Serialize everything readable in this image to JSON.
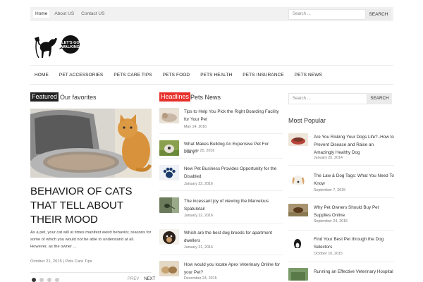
{
  "top_nav": {
    "items": [
      "Home",
      "About US",
      "Contact US"
    ],
    "search_placeholder": "Search ...",
    "search_button": "SEARCH"
  },
  "logo": {
    "text": "LET'S GO WALKING"
  },
  "main_nav": {
    "items": [
      "HOME",
      "PET ACCESSORIES",
      "PETS CARE TIPS",
      "PETS FOOD",
      "PETS HEALTH",
      "PETS INSURANCE",
      "PETS NEWS"
    ]
  },
  "featured": {
    "tag": "Featured",
    "subtitle": "Our favorites",
    "tag_color": "#222222",
    "title": "BEHAVIOR OF CATS THAT TELL ABOUT THEIR MOOD",
    "excerpt": "As a pet, your cat will at times manifest weird behavior, reasons for some of which you would not be able to understand at all. However, as the owner ...",
    "date": "October 21, 2015",
    "separator": "|",
    "category": "Pets Care Tips",
    "slider_dots": 4,
    "active_dot": 0,
    "prev": "PREV",
    "next": "NEXT"
  },
  "headlines": {
    "tag": "Headlines",
    "subtitle": "Pets News",
    "tag_color": "#e8302a",
    "items": [
      {
        "title": "Tips to Help You Pick the Right Boarding Facility for Your Pet",
        "date": "May 14, 2016",
        "thumb": "dog-sleeping",
        "thumb_color": "#c9b8a6"
      },
      {
        "title": "What Makes Bulldog An Expensive Pet For Many?",
        "date": "February 25, 2016",
        "thumb": "bulldog",
        "thumb_color": "#7d8f4a"
      },
      {
        "title": "New Pet Business Provides Opportunity for the Disabled",
        "date": "January 22, 2016",
        "thumb": "paw-print",
        "thumb_color": "#e8eef4"
      },
      {
        "title": "The incessant joy of viewing the Marvelous Spatuletail",
        "date": "January 22, 2016",
        "thumb": "bird",
        "thumb_color": "#5a6a4c"
      },
      {
        "title": "Which are the best dog breeds for apartment dwellers",
        "date": "January 21, 2016",
        "thumb": "dog-face",
        "thumb_color": "#3a2c22"
      },
      {
        "title": "How would you locate Apex Veterinary Online for your Pet?",
        "date": "December 24, 2015",
        "thumb": "puppies",
        "thumb_color": "#d8c29e"
      }
    ]
  },
  "sidebar": {
    "search_placeholder": "Search ...",
    "search_button": "SEARCH",
    "popular_title": "Most Popular",
    "items": [
      {
        "title": "Are You Risking Your Dogs Life?..How to Prevent Disease and Raise an Amazingly Healthy Dog",
        "date": "January 25, 2014",
        "thumb": "dog-food",
        "thumb_color": "#b8443a"
      },
      {
        "title": "The Law & Dog Tags: What You Need To Know",
        "date": "September 7, 2015",
        "thumb": "beagle",
        "thumb_color": "#d9a46a"
      },
      {
        "title": "Why Pet Owners Should Buy Pet Supplies Online",
        "date": "September 24, 2015",
        "thumb": "dog-running",
        "thumb_color": "#8a6a3a"
      },
      {
        "title": "Find Your Best Pet through the Dog Selectors",
        "date": "October 16, 2015",
        "thumb": "dog-black-white",
        "thumb_color": "#ffffff"
      },
      {
        "title": "Running an Effective Veterinary Hospital",
        "date": "",
        "thumb": "vet",
        "thumb_color": "#6a8a5a"
      }
    ]
  }
}
